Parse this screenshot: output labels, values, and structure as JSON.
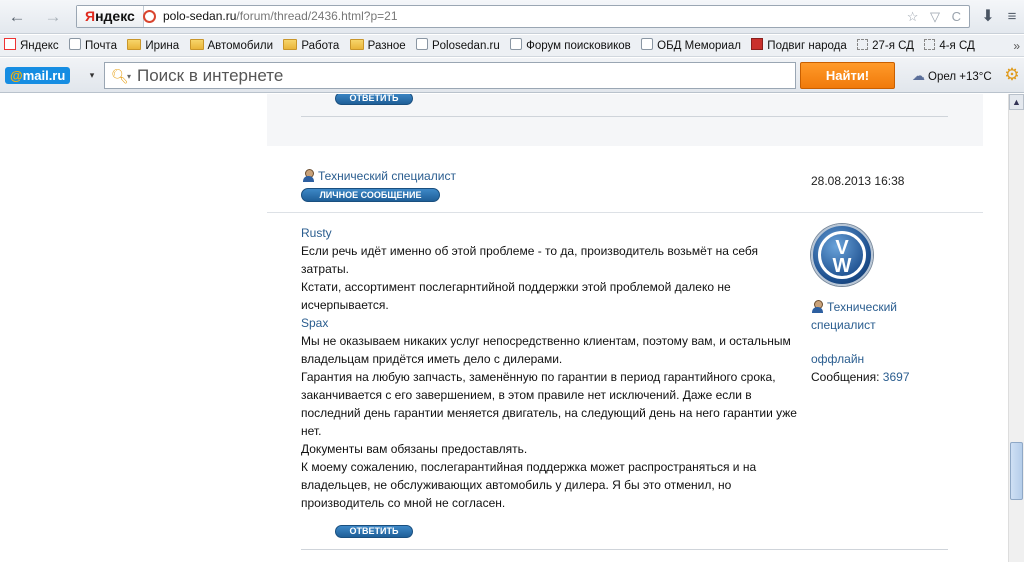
{
  "browser": {
    "yandex_badge_first": "Я",
    "yandex_badge_rest": "ндекс",
    "url_host": "polo-sedan.ru",
    "url_path": "/forum/thread/2436.html?p=21",
    "url_icons": "☆ ▽ C",
    "back_glyph": "←",
    "forward_glyph": "→",
    "download_glyph": "⬇",
    "menu_glyph": "≡"
  },
  "bookmarks": [
    {
      "label": "Яндекс",
      "icon": "yandex-icon"
    },
    {
      "label": "Почта",
      "icon": "page-icon"
    },
    {
      "label": "Ирина",
      "icon": "folder-icon"
    },
    {
      "label": "Автомобили",
      "icon": "folder-icon"
    },
    {
      "label": "Работа",
      "icon": "folder-icon"
    },
    {
      "label": "Разное",
      "icon": "folder-icon"
    },
    {
      "label": "Polosedan.ru",
      "icon": "page-icon"
    },
    {
      "label": "Форум поисковиков",
      "icon": "page-icon"
    },
    {
      "label": "ОБД Мемориал",
      "icon": "page-icon"
    },
    {
      "label": "Подвиг народа",
      "icon": "gift-icon"
    },
    {
      "label": "27-я СД",
      "icon": "dashed-icon"
    },
    {
      "label": "4-я СД",
      "icon": "dashed-icon"
    }
  ],
  "bookmarks_overflow": "»",
  "search_toolbar": {
    "logo_at": "@",
    "logo_text": "mail.ru",
    "dropdown_glyph": "▾",
    "placeholder": "Поиск в интернете",
    "button_label": "Найти!",
    "weather": "Орел +13°C",
    "weather_glyph": "☁",
    "settings_glyph": "⚙"
  },
  "post_prev": {
    "reply_label": "ОТВЕТИТЬ"
  },
  "post": {
    "author": "Технический специалист",
    "pm_label": "ЛИЧНОЕ СООБЩЕНИЕ",
    "date": "28.08.2013 16:38",
    "quote1_name": "Rusty",
    "quote1_text": "Если речь идёт именно об этой проблеме - то да, производитель возьмёт на себя затраты.",
    "quote1_text2": "Кстати, ассортимент послегарнтийной поддержки этой проблемой далеко не исчерпывается.",
    "quote2_name": "Spax",
    "reply_para1": "Мы не оказываем никаких услуг непосредственно клиентам, поэтому вам, и остальным владельцам придётся иметь дело с дилерами.",
    "reply_para2": "Гарантия на любую запчасть, заменённую по гарантии в период гарантийного срока, заканчивается с его завершением, в этом правиле нет исключений. Даже если в последний день гарантии меняется двигатель, на следующий день на него гарантии уже нет.",
    "reply_para3": "Документы вам обязаны предоставлять.",
    "reply_para4": "К моему сожалению, послегарантийная поддержка может распространяться и на владельцев, не обслуживающих автомобиль у дилера. Я бы это отменил, но производитель со мной не согласен.",
    "reply_label": "ОТВЕТИТЬ",
    "avatar_v": "V",
    "avatar_w": "W",
    "side_role": "Технический специалист",
    "side_status": "оффлайн",
    "side_messages_label": "Сообщения: ",
    "side_messages_count": "3697"
  },
  "scrollbar": {
    "up_glyph": "▲"
  }
}
